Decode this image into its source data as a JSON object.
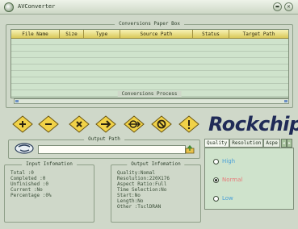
{
  "window": {
    "title": "AVConverter",
    "minimize_label": "▬",
    "close_label": "✕"
  },
  "paper_box": {
    "title": "Conversions Paper Box"
  },
  "table": {
    "columns": [
      "File Name",
      "Size",
      "Type",
      "Source Path",
      "Status",
      "Target Path"
    ],
    "rows": []
  },
  "process": {
    "title": "Conversions Process",
    "progress": 0
  },
  "toolbar": {
    "buttons": [
      {
        "name": "add-button",
        "icon": "plus-icon"
      },
      {
        "name": "remove-button",
        "icon": "minus-icon"
      },
      {
        "name": "clear-button",
        "icon": "x-icon"
      },
      {
        "name": "convert-button",
        "icon": "arrow-right-icon"
      },
      {
        "name": "target-button",
        "icon": "theta-arrow-icon"
      },
      {
        "name": "stop-button",
        "icon": "stop-icon"
      },
      {
        "name": "info-button",
        "icon": "exclamation-icon"
      }
    ]
  },
  "brand": {
    "logo": "Rockchip"
  },
  "output_path": {
    "title": "Output Path",
    "value": ""
  },
  "tabs": {
    "items": [
      "Quality",
      "Resolution",
      "Aspe"
    ],
    "active": "Quality"
  },
  "quality": {
    "options": [
      {
        "label": "High",
        "checked": false,
        "color": "#4aa0d8"
      },
      {
        "label": "Normal",
        "checked": true,
        "color": "#e87878"
      },
      {
        "label": "Low",
        "checked": false,
        "color": "#4aa0d8"
      }
    ]
  },
  "input_info": {
    "title": "Input Infomation",
    "text": "Total :0\nCompleted :0\nUnfinished :0\nCurrent :No\nPercentage :0%"
  },
  "output_info": {
    "title": "Output Infomation",
    "text": "Quality:Nomal\nResolution:220X176\nAspect Ratio:Full\nTime Selection:No\nStart:No\nLength:No\nOther :TsclDRAN"
  }
}
